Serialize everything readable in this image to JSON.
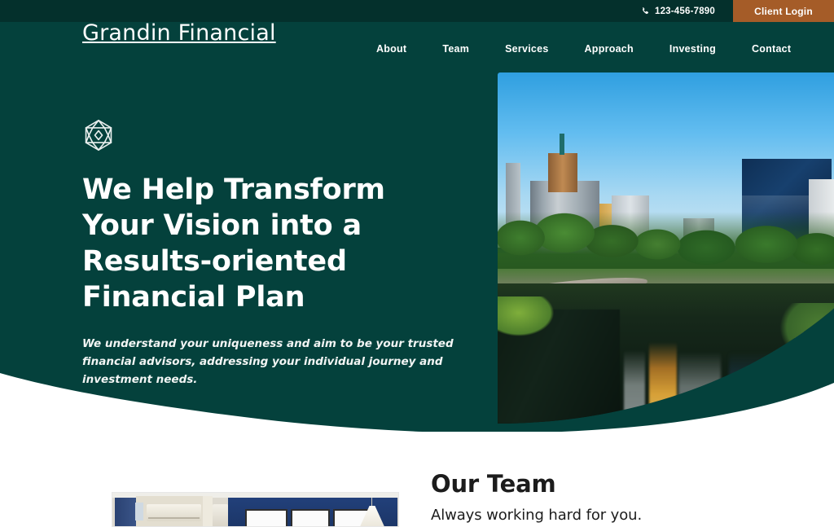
{
  "topbar": {
    "phone_icon": "phone-icon",
    "phone": "123-456-7890",
    "client_login_label": "Client Login",
    "button_color": "#A55C28",
    "background_color": "#04302C"
  },
  "header": {
    "brand": "Grandin Financial",
    "background_color": "#04413C",
    "nav": [
      {
        "label": "About"
      },
      {
        "label": "Team"
      },
      {
        "label": "Services"
      },
      {
        "label": "Approach"
      },
      {
        "label": "Investing"
      },
      {
        "label": "Contact"
      }
    ]
  },
  "hero": {
    "badge_icon": "gem-hexagon-icon",
    "title": "We Help Transform Your Vision into a Results-oriented Financial Plan",
    "subtitle": "We understand your uniqueness and aim to be your trusted financial advisors, addressing your individual journey and investment needs.",
    "image_alt": "New York City skyline with Central Park pond and The Plaza Hotel",
    "background_color": "#04413C",
    "text_color": "#FFFFFF"
  },
  "team": {
    "heading": "Our Team",
    "subheading": "Always working hard for you.",
    "image_alt": "Office interior with navy wall, air conditioner and pendant lamp",
    "text_color": "#1C1C1C"
  }
}
